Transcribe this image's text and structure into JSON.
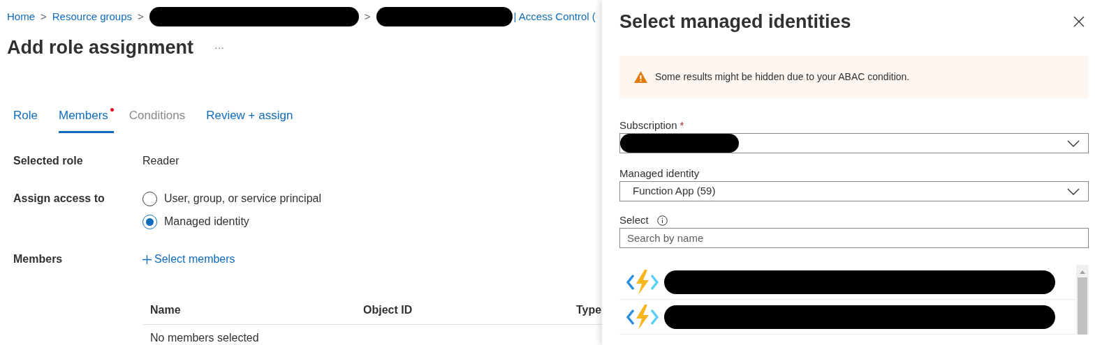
{
  "breadcrumb": {
    "separator": ">",
    "items": [
      {
        "kind": "link",
        "label": "Home"
      },
      {
        "kind": "link",
        "label": "Resource groups"
      },
      {
        "kind": "redacted"
      },
      {
        "kind": "redacted",
        "suffix": "| Access Control ("
      }
    ]
  },
  "page_title": "Add role assignment",
  "more_menu": "···",
  "tabs": [
    {
      "label": "Role",
      "selected": false,
      "disabled": false,
      "attention": false
    },
    {
      "label": "Members",
      "selected": true,
      "disabled": false,
      "attention": true
    },
    {
      "label": "Conditions",
      "selected": false,
      "disabled": true,
      "attention": false
    },
    {
      "label": "Review + assign",
      "selected": false,
      "disabled": false,
      "attention": false
    }
  ],
  "selected_role": {
    "label": "Selected role",
    "value": "Reader"
  },
  "assign_access": {
    "label": "Assign access to",
    "options": [
      {
        "label": "User, group, or service principal",
        "selected": false
      },
      {
        "label": "Managed identity",
        "selected": true
      }
    ]
  },
  "members": {
    "label": "Members",
    "action": "Select members"
  },
  "members_table": {
    "columns": [
      "Name",
      "Object ID",
      "Type"
    ],
    "empty_text": "No members selected"
  },
  "panel": {
    "title": "Select managed identities",
    "warning": "Some results might be hidden due to your ABAC condition.",
    "subscription": {
      "label": "Subscription",
      "required_mark": "*",
      "redacted": true
    },
    "managed_identity": {
      "label": "Managed identity",
      "value": "Function App (59)"
    },
    "select": {
      "label": "Select",
      "placeholder": "Search by name"
    },
    "results": [
      {
        "kind": "function-app",
        "redacted": true
      },
      {
        "kind": "function-app",
        "redacted": true
      }
    ]
  }
}
